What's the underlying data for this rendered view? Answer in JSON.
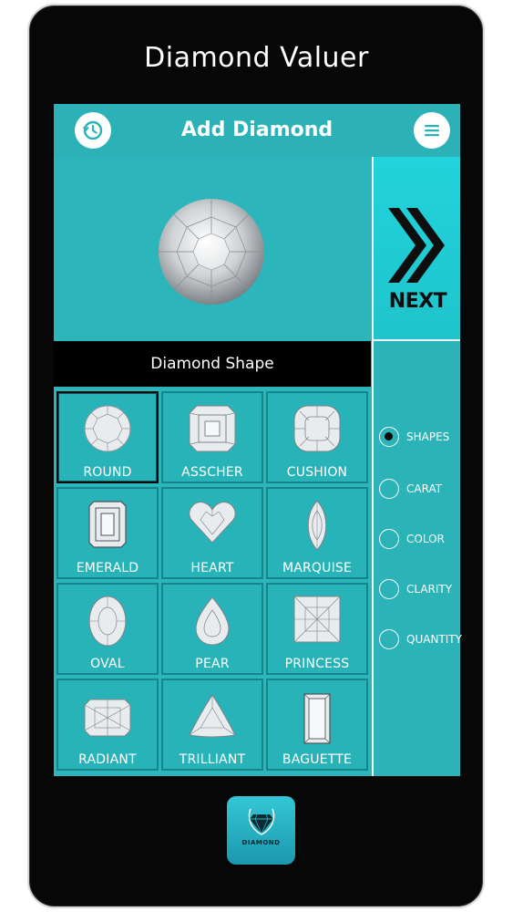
{
  "app": {
    "title": "Diamond Valuer"
  },
  "topbar": {
    "title": "Add Diamond",
    "left_icon": "history-icon",
    "right_icon": "menu-icon"
  },
  "hero": {
    "image": "round-diamond"
  },
  "next": {
    "label": "NEXT",
    "icon": "double-chevron-right-icon"
  },
  "shape_section": {
    "header": "Diamond Shape"
  },
  "shapes": [
    {
      "label": "ROUND",
      "gem": "round",
      "selected": true
    },
    {
      "label": "ASSCHER",
      "gem": "asscher",
      "selected": false
    },
    {
      "label": "CUSHION",
      "gem": "cushion",
      "selected": false
    },
    {
      "label": "EMERALD",
      "gem": "emerald",
      "selected": false
    },
    {
      "label": "HEART",
      "gem": "heart",
      "selected": false
    },
    {
      "label": "MARQUISE",
      "gem": "marquise",
      "selected": false
    },
    {
      "label": "OVAL",
      "gem": "oval",
      "selected": false
    },
    {
      "label": "PEAR",
      "gem": "pear",
      "selected": false
    },
    {
      "label": "PRINCESS",
      "gem": "princess",
      "selected": false
    },
    {
      "label": "RADIANT",
      "gem": "radiant",
      "selected": false
    },
    {
      "label": "TRILLIANT",
      "gem": "trilliant",
      "selected": false
    },
    {
      "label": "BAGUETTE",
      "gem": "baguette",
      "selected": false
    }
  ],
  "steps": [
    {
      "label": "SHAPES",
      "selected": true
    },
    {
      "label": "CARAT",
      "selected": false
    },
    {
      "label": "COLOR",
      "selected": false
    },
    {
      "label": "CLARITY",
      "selected": false
    },
    {
      "label": "QUANTITY",
      "selected": false
    }
  ],
  "logo": {
    "text": "DIAMOND"
  },
  "colors": {
    "accent": "#2cb3b8",
    "next_bg": "#1ec8d0",
    "frame": "#070707"
  }
}
